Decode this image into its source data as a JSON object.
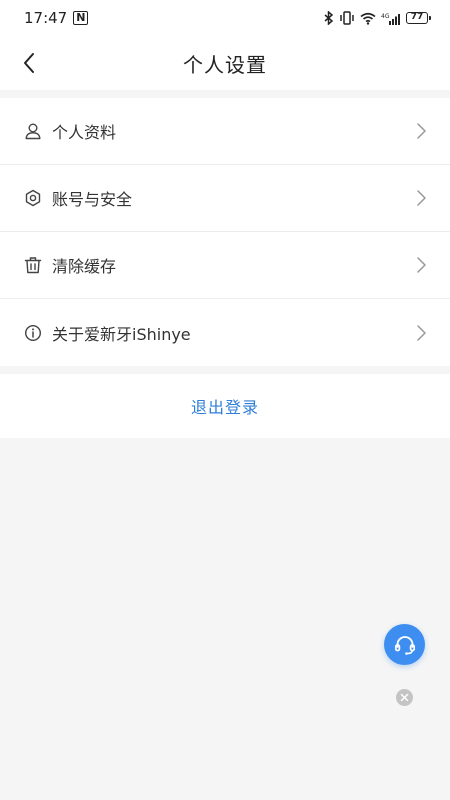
{
  "status_bar": {
    "time": "17:47",
    "nfc": "N",
    "battery": "77"
  },
  "nav": {
    "title": "个人设置"
  },
  "menu": {
    "items": [
      {
        "label": "个人资料",
        "icon": "user-icon"
      },
      {
        "label": "账号与安全",
        "icon": "gear-icon"
      },
      {
        "label": "清除缓存",
        "icon": "trash-icon"
      },
      {
        "label": "关于爱新牙iShinye",
        "icon": "info-icon"
      }
    ]
  },
  "logout": {
    "label": "退出登录"
  },
  "colors": {
    "accent": "#2f7fd8",
    "fab": "#3d8ef0",
    "background": "#f5f5f5"
  }
}
